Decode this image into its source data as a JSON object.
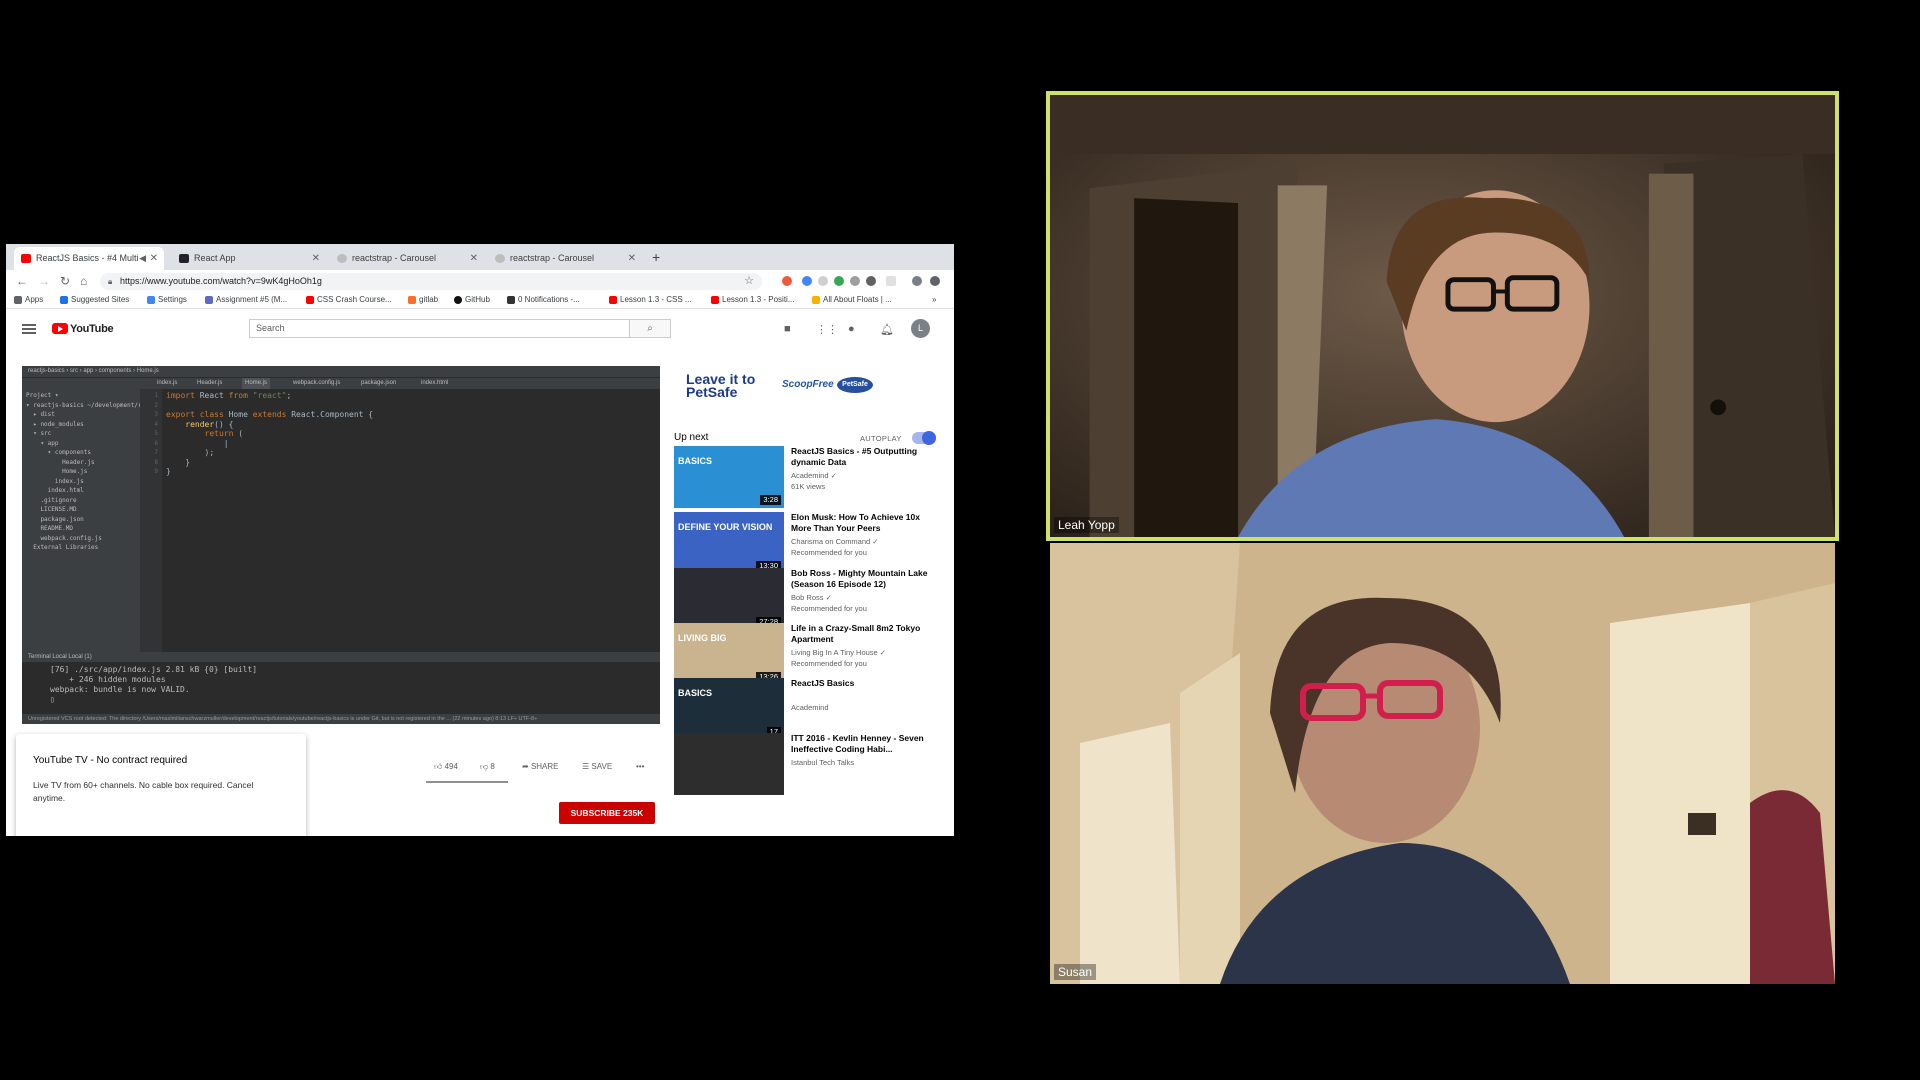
{
  "browser": {
    "tabs": [
      {
        "title": "ReactJS Basics - #4 Multi",
        "active": true,
        "favicon_color": "#ff0000"
      },
      {
        "title": "React App",
        "active": false,
        "favicon_color": "#20232a"
      },
      {
        "title": "reactstrap - Carousel",
        "active": false,
        "favicon_color": "#bdbdbd"
      },
      {
        "title": "reactstrap - Carousel",
        "active": false,
        "favicon_color": "#bdbdbd"
      }
    ],
    "new_tab": "+",
    "url": "https://www.youtube.com/watch?v=9wK4gHoOh1g",
    "bookmarks": [
      "Apps",
      "Suggested Sites",
      "Settings",
      "Assignment #5 (M...",
      "CSS Crash Course...",
      "gitlab",
      "GitHub",
      "0 Notifications -...",
      "Lesson 1.3 - CSS ...",
      "Lesson 1.3 - Positi...",
      "All About Floats | ..."
    ],
    "bookmarks_more": "»"
  },
  "youtube": {
    "logo": "YouTube",
    "search_placeholder": "Search",
    "avatar_initial": "L",
    "ide": {
      "breadcrumb": "reactjs-basics  ›  src  ›  app  ›  components  ›  Home.js",
      "tabs": [
        "index.js",
        "Header.js",
        "Home.js",
        "webpack.config.js",
        "package.json",
        "index.html"
      ],
      "tree": [
        "Project ▾",
        "▾ reactjs-basics ~/development/react",
        "  ▸ dist",
        "  ▸ node_modules",
        "  ▾ src",
        "    ▾ app",
        "      ▾ components",
        "          Header.js",
        "          Home.js",
        "        index.js",
        "      index.html",
        "    .gitignore",
        "    LICENSE.MD",
        "    package.json",
        "    README.MD",
        "    webpack.config.js",
        "  External Libraries"
      ],
      "gutter": "1\n2\n3\n4\n5\n6\n7\n8\n9",
      "code_lines": [
        [
          "kw:import",
          " React ",
          "kw:from",
          " ",
          "str:\"react\"",
          ";"
        ],
        [
          ""
        ],
        [
          "kw:export class",
          " Home ",
          "kw:extends",
          " React.Component {"
        ],
        [
          "    ",
          "fn:render",
          "() {"
        ],
        [
          "        ",
          "kw:return",
          " ("
        ],
        [
          "            |"
        ],
        [
          "        );"
        ],
        [
          "    }"
        ],
        [
          "}"
        ]
      ],
      "terminal_tabs": "Terminal    Local    Local (1)",
      "terminal": "[76] ./src/app/index.js 2.81 kB {0} [built]\n    + 246 hidden modules\nwebpack: bundle is now VALID.\n▯",
      "status": "Unregistered VCS root detected: The directory /Users/maxlmilianschwarzmuller/development/reactjs/tutorials/youtube/reactjs-basics is under Git, but is not registered in the ... (22 minutes ago)   8:13   LF÷   UTF-8÷"
    },
    "ad": {
      "headline": "Leave it to PetSafe",
      "brand1": "ScoopFree",
      "brand2": "PetSafe"
    },
    "up_next": "Up next",
    "autoplay": "AUTOPLAY",
    "recommendations": [
      {
        "title": "ReactJS Basics - #5 Outputting dynamic Data",
        "channel": "Academind ✓",
        "meta": "61K views",
        "duration": "3:28",
        "thumb_label": "BASICS",
        "thumb_color": "#2a8fd3"
      },
      {
        "title": "Elon Musk: How To Achieve 10x More Than Your Peers",
        "channel": "Charisma on Command ✓",
        "meta": "Recommended for you",
        "duration": "13:30",
        "thumb_label": "DEFINE YOUR VISION",
        "thumb_color": "#3b63c4"
      },
      {
        "title": "Bob Ross - Mighty Mountain Lake (Season 16 Episode 12)",
        "channel": "Bob Ross ✓",
        "meta": "Recommended for you",
        "duration": "27:28",
        "thumb_label": "",
        "thumb_color": "#2b2b33"
      },
      {
        "title": "Life in a Crazy-Small 8m2 Tokyo Apartment",
        "channel": "Living Big In A Tiny House ✓",
        "meta": "Recommended for you",
        "duration": "13:26",
        "thumb_label": "LIVING BIG",
        "thumb_color": "#c9b48f"
      },
      {
        "title": "ReactJS Basics",
        "channel": "Academind",
        "meta": "",
        "duration": "17",
        "thumb_label": "BASICS",
        "thumb_color": "#1e2d3a"
      },
      {
        "title": "ITT 2016 - Kevlin Henney - Seven Ineffective Coding Habi...",
        "channel": "Istanbul Tech Talks",
        "meta": "",
        "duration": "",
        "thumb_label": "",
        "thumb_color": "#2d2d2d"
      }
    ],
    "actions": {
      "likes": "494",
      "dislikes": "8",
      "share": "SHARE",
      "save": "SAVE",
      "more": "•••"
    },
    "subscribe": "SUBSCRIBE  235K",
    "toast": {
      "title": "YouTube TV - No contract required",
      "body": "Live TV from 60+ channels. No cable box required. Cancel anytime."
    }
  },
  "participants": [
    {
      "name": "Leah Yopp",
      "speaking": true,
      "highlight_color": "#cfe06b"
    },
    {
      "name": "Susan",
      "speaking": false
    }
  ]
}
